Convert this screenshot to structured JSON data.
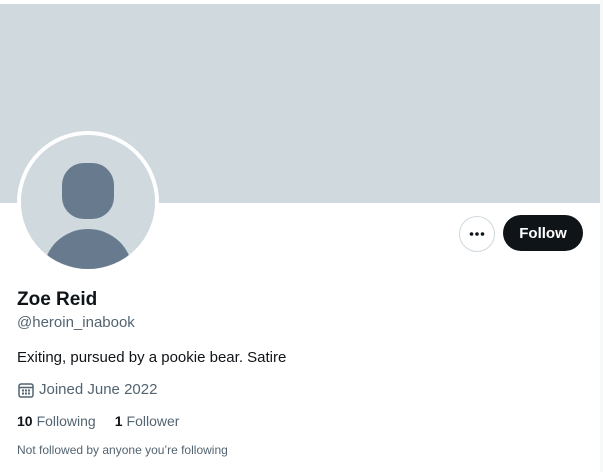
{
  "profile": {
    "name": "Zoe Reid",
    "handle": "@heroin_inabook",
    "bio": "Exiting, pursued by a pookie bear. Satire",
    "joined": "Joined June 2022",
    "following_count": "10",
    "following_label": "Following",
    "followers_count": "1",
    "followers_label": "Follower",
    "not_followed_text": "Not followed by anyone you’re following"
  },
  "actions": {
    "follow_label": "Follow",
    "more_icon": "more-horizontal-icon"
  },
  "icons": {
    "calendar": "calendar-icon",
    "avatar": "default-avatar-silhouette"
  },
  "colors": {
    "banner": "#cfd9de",
    "follow_button_bg": "#0f1419",
    "follow_button_text": "#ffffff",
    "secondary_text": "#536471",
    "primary_text": "#0f1419",
    "avatar_silhouette": "#687b8e"
  }
}
